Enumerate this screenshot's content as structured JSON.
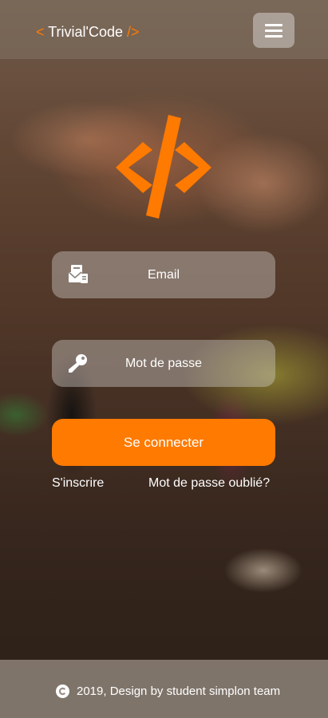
{
  "header": {
    "brand_open": "<",
    "brand_name": "Trivial'Code",
    "brand_close": "/>",
    "menu_icon": "hamburger-icon"
  },
  "logo": {
    "icon": "code-brackets-icon",
    "color": "#ff7a00"
  },
  "form": {
    "email": {
      "placeholder": "Email",
      "value": "",
      "icon": "email-card-icon"
    },
    "password": {
      "placeholder": "Mot de passe",
      "value": "",
      "icon": "key-icon"
    },
    "submit_label": "Se connecter"
  },
  "links": {
    "register": "S'inscrire",
    "forgot_password": "Mot de passe oublié?"
  },
  "footer": {
    "icon": "copyright-icon",
    "text": "2019, Design by student simplon team"
  },
  "colors": {
    "accent": "#ff7a00"
  }
}
